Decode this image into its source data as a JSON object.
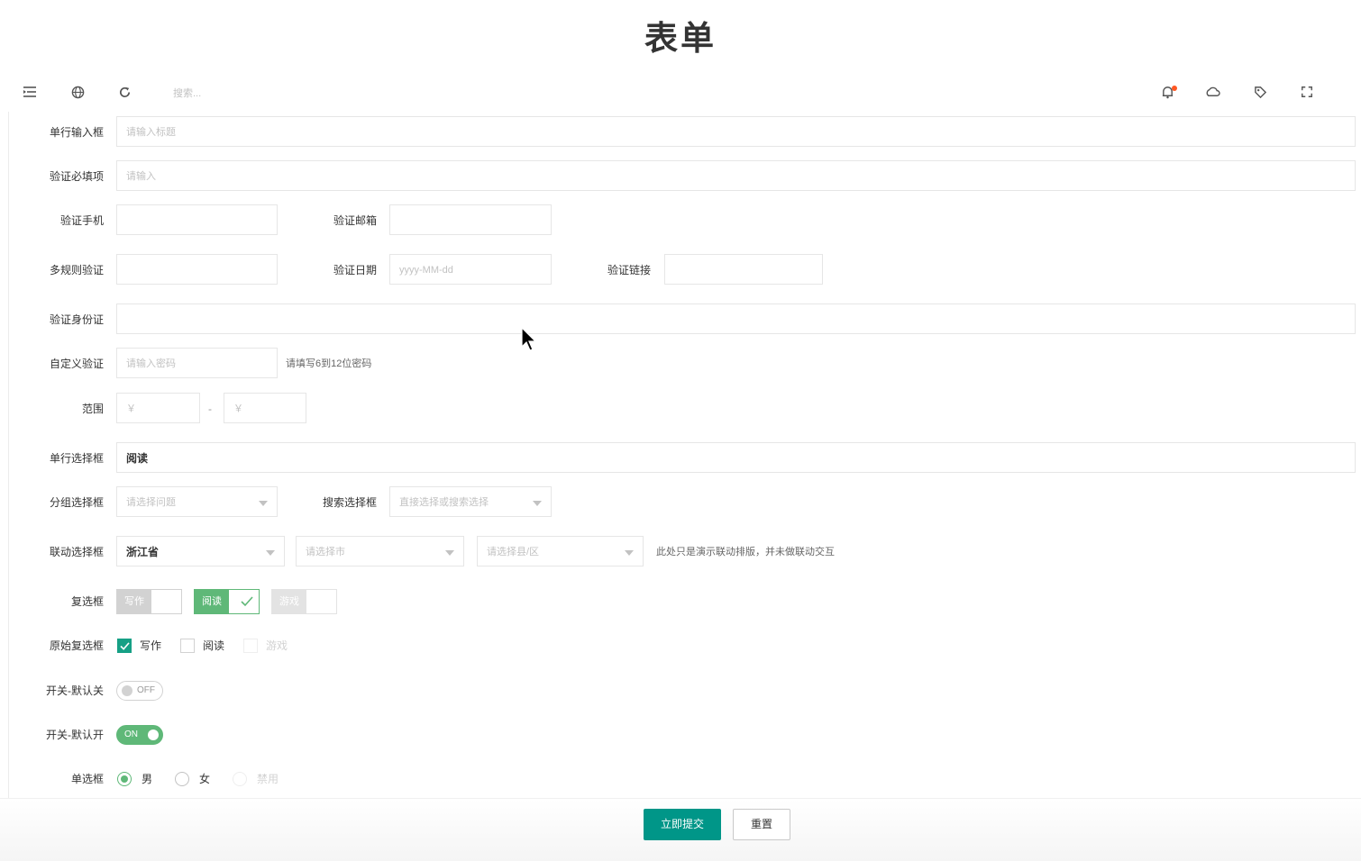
{
  "page": {
    "title": "表单"
  },
  "toolbar": {
    "search_placeholder": "搜索..."
  },
  "form": {
    "single_input": {
      "label": "单行输入框",
      "placeholder": "请输入标题"
    },
    "required": {
      "label": "验证必填项",
      "placeholder": "请输入"
    },
    "phone": {
      "label": "验证手机",
      "value": ""
    },
    "email": {
      "label": "验证邮箱",
      "value": ""
    },
    "multi_rule": {
      "label": "多规则验证",
      "value": ""
    },
    "date": {
      "label": "验证日期",
      "placeholder": "yyyy-MM-dd"
    },
    "url": {
      "label": "验证链接",
      "value": ""
    },
    "id_card": {
      "label": "验证身份证",
      "value": ""
    },
    "custom": {
      "label": "自定义验证",
      "placeholder": "请输入密码",
      "aux": "请填写6到12位密码"
    },
    "range": {
      "label": "范围",
      "from_placeholder": "￥",
      "dash": "-",
      "to_placeholder": "￥"
    },
    "single_select": {
      "label": "单行选择框",
      "value": "阅读"
    },
    "group_select": {
      "label": "分组选择框",
      "placeholder": "请选择问题"
    },
    "search_select": {
      "label": "搜索选择框",
      "placeholder": "直接选择或搜索选择"
    },
    "linked_select": {
      "label": "联动选择框",
      "province": "浙江省",
      "city_placeholder": "请选择市",
      "district_placeholder": "请选择县/区",
      "aux": "此处只是演示联动排版，并未做联动交互"
    },
    "checkbox": {
      "label": "复选框",
      "items": [
        {
          "text": "写作",
          "checked": false
        },
        {
          "text": "阅读",
          "checked": true
        },
        {
          "text": "游戏",
          "checked": false,
          "disabled": true
        }
      ]
    },
    "primitive_checkbox": {
      "label": "原始复选框",
      "items": [
        {
          "text": "写作",
          "checked": true
        },
        {
          "text": "阅读",
          "checked": false
        },
        {
          "text": "游戏",
          "checked": false,
          "disabled": true
        }
      ]
    },
    "switch_off": {
      "label": "开关-默认关",
      "text": "OFF"
    },
    "switch_on": {
      "label": "开关-默认开",
      "text": "ON"
    },
    "radio": {
      "label": "单选框",
      "items": [
        {
          "text": "男",
          "checked": true
        },
        {
          "text": "女",
          "checked": false
        },
        {
          "text": "禁用",
          "disabled": true
        }
      ]
    }
  },
  "buttons": {
    "submit": "立即提交",
    "reset": "重置"
  },
  "colors": {
    "primary": "#009688",
    "green": "#5fb878",
    "accent_red": "#ff5722"
  }
}
